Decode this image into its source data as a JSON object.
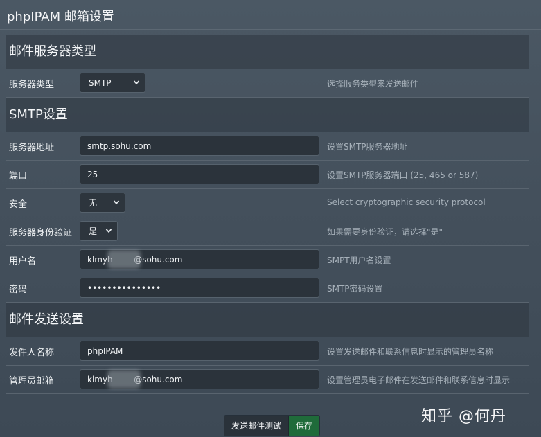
{
  "page": {
    "title": "phpIPAM 邮箱设置"
  },
  "sections": {
    "server_type": {
      "title": "邮件服务器类型",
      "rows": {
        "type": {
          "label": "服务器类型",
          "selected": "SMTP",
          "help": "选择服务类型来发送邮件"
        }
      }
    },
    "smtp": {
      "title": "SMTP设置",
      "rows": {
        "server": {
          "label": "服务器地址",
          "value": "smtp.sohu.com",
          "help": "设置SMTP服务器地址"
        },
        "port": {
          "label": "端口",
          "value": "25",
          "help": "设置SMTP服务器端口 (25, 465 or 587)"
        },
        "security": {
          "label": "安全",
          "selected": "无",
          "help": "Select cryptographic security protocol"
        },
        "auth": {
          "label": "服务器身份验证",
          "selected": "是",
          "help": "如果需要身份验证，请选择\"是\""
        },
        "username": {
          "label": "用户名",
          "value": "klmyh        @sohu.com",
          "help": "SMPT用户名设置"
        },
        "password": {
          "label": "密码",
          "value": "•••••••••••••••",
          "help": "SMTP密码设置"
        }
      }
    },
    "sending": {
      "title": "邮件发送设置",
      "rows": {
        "sender_name": {
          "label": "发件人名称",
          "value": "phpIPAM",
          "help": "设置发送邮件和联系信息时显示的管理员名称"
        },
        "admin_email": {
          "label": "管理员邮箱",
          "value": "klmyh        @sohu.com",
          "help": "设置管理员电子邮件在发送邮件和联系信息时显示"
        }
      }
    }
  },
  "actions": {
    "test_label": "发送邮件测试",
    "save_label": "保存",
    "save_color": "#1f6b3a"
  },
  "watermark": {
    "text": "知乎 @何丹"
  }
}
